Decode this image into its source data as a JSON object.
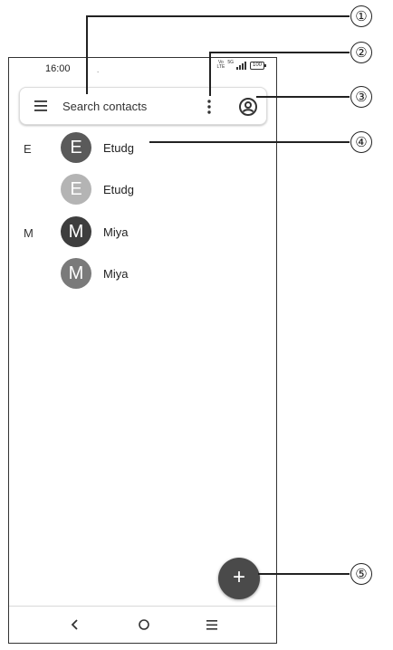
{
  "status_bar": {
    "time": "16:00",
    "dot": ".",
    "volte_top": "Vo",
    "volte_bottom": "LTE",
    "network": "5G",
    "battery": "100"
  },
  "search": {
    "placeholder": "Search contacts"
  },
  "contacts": [
    {
      "section": "E",
      "initial": "E",
      "name": "Etudg",
      "avatar_color": "#5a5a5a"
    },
    {
      "section": "",
      "initial": "E",
      "name": "Etudg",
      "avatar_color": "#b4b4b4"
    },
    {
      "section": "M",
      "initial": "M",
      "name": "Miya",
      "avatar_color": "#3e3e3e"
    },
    {
      "section": "",
      "initial": "M",
      "name": "Miya",
      "avatar_color": "#7a7a7a"
    }
  ],
  "fab": {
    "label": "+"
  },
  "callouts": [
    "①",
    "②",
    "③",
    "④",
    "⑤"
  ]
}
